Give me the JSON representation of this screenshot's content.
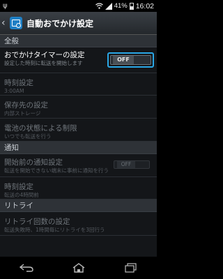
{
  "status_bar": {
    "battery_percent": "41%",
    "time": "16:02"
  },
  "action_bar": {
    "title": "自動おでかけ設定"
  },
  "sections": [
    {
      "header": "全般",
      "items": [
        {
          "title": "おでかけタイマーの設定",
          "subtitle": "設定した時刻に転送を開始します",
          "toggle": "OFF"
        },
        {
          "title": "時刻設定",
          "subtitle": "3:00AM"
        },
        {
          "title": "保存先の設定",
          "subtitle": "内部ストレージ"
        },
        {
          "title": "電池の状態による制限",
          "subtitle": "いつでも転送を行う"
        }
      ]
    },
    {
      "header": "通知",
      "items": [
        {
          "title": "開始前の通知設定",
          "subtitle": "転送を開始できない端末に事前に通知を行う",
          "toggle": "OFF"
        },
        {
          "title": "時刻設定",
          "subtitle": "転送の4時間前"
        }
      ]
    },
    {
      "header": "リトライ",
      "items": [
        {
          "title": "リトライ回数の設定",
          "subtitle": "転送失敗時、1時間毎にリトライを3回行う"
        }
      ]
    }
  ],
  "colors": {
    "focus_ring": "#2aa7e6",
    "background": "#141619",
    "section_header": "#2e3237"
  }
}
